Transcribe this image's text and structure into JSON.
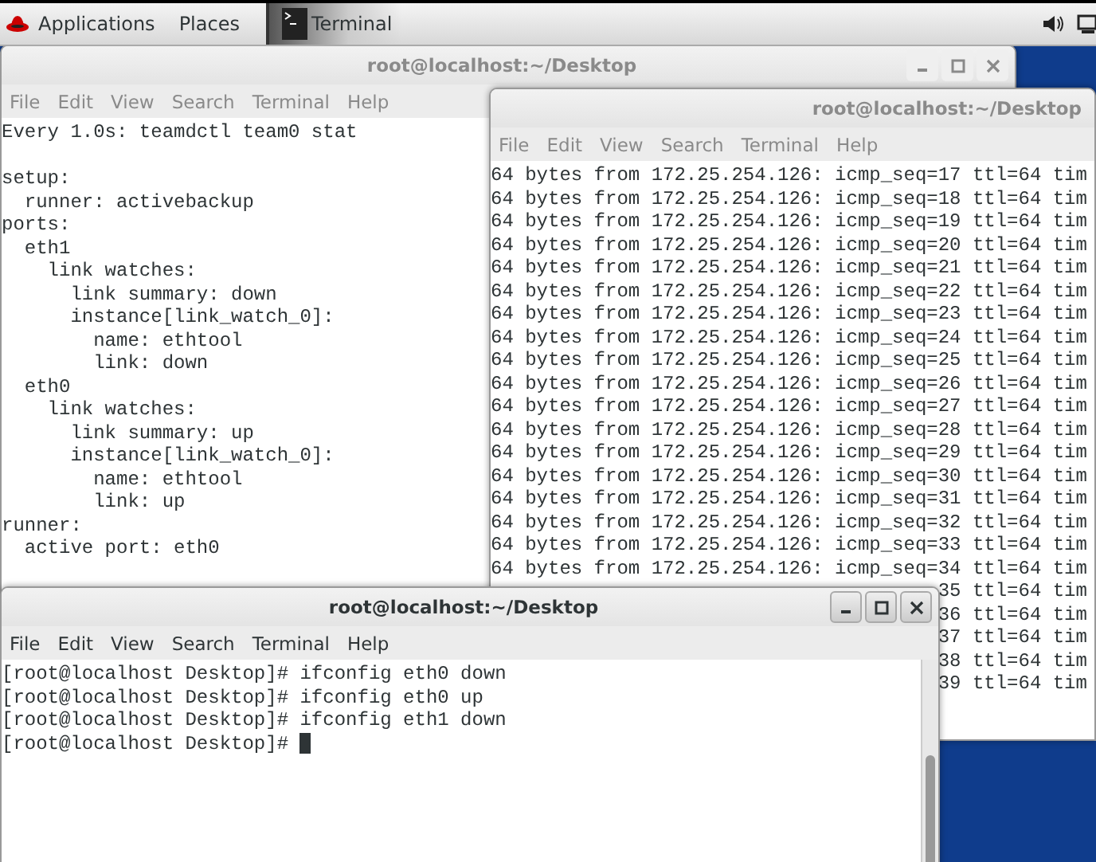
{
  "top_bar": {
    "menus": [
      "Applications",
      "Places"
    ],
    "task": {
      "label": "Terminal"
    }
  },
  "windows": [
    {
      "title": "root@localhost:~/Desktop",
      "active": false,
      "menu": [
        "File",
        "Edit",
        "View",
        "Search",
        "Terminal",
        "Help"
      ],
      "cursor": false,
      "lines": [
        {
          "text": "Every 1.0s: teamdctl team0 stat",
          "kind": "full"
        },
        {
          "text": "setup:",
          "kind": "gap"
        },
        {
          "text": "  runner: activebackup",
          "kind": "full"
        },
        {
          "text": "ports:",
          "kind": "full"
        },
        {
          "text": "  eth1",
          "kind": "full"
        },
        {
          "text": "    link watches:",
          "kind": "full"
        },
        {
          "text": "      link summary: down",
          "kind": "full"
        },
        {
          "text": "      instance[link_watch_0]:",
          "kind": "full"
        },
        {
          "text": "        name: ethtool",
          "kind": "full"
        },
        {
          "text": "        link: down",
          "kind": "full"
        },
        {
          "text": "  eth0",
          "kind": "full"
        },
        {
          "text": "    link watches:",
          "kind": "full"
        },
        {
          "text": "      link summary: up",
          "kind": "full"
        },
        {
          "text": "      instance[link_watch_0]:",
          "kind": "full"
        },
        {
          "text": "        name: ethtool",
          "kind": "full"
        },
        {
          "text": "        link: up",
          "kind": "full"
        },
        {
          "text": "runner:",
          "kind": "full"
        },
        {
          "text": "  active port: eth0",
          "kind": "full"
        }
      ]
    },
    {
      "title": "root@localhost:~/Desktop",
      "active": false,
      "menu": [
        "File",
        "Edit",
        "View",
        "Search",
        "Terminal",
        "Help"
      ],
      "cursor": false,
      "lines": [
        {
          "text": "64 bytes from 172.25.254.126: icmp_seq=17 ttl=64 tim",
          "kind": "full"
        },
        {
          "text": "64 bytes from 172.25.254.126: icmp_seq=18 ttl=64 tim",
          "kind": "full"
        },
        {
          "text": "64 bytes from 172.25.254.126: icmp_seq=19 ttl=64 tim",
          "kind": "full"
        },
        {
          "text": "64 bytes from 172.25.254.126: icmp_seq=20 ttl=64 tim",
          "kind": "full"
        },
        {
          "text": "64 bytes from 172.25.254.126: icmp_seq=21 ttl=64 tim",
          "kind": "full"
        },
        {
          "text": "64 bytes from 172.25.254.126: icmp_seq=22 ttl=64 tim",
          "kind": "full"
        },
        {
          "text": "64 bytes from 172.25.254.126: icmp_seq=23 ttl=64 tim",
          "kind": "full"
        },
        {
          "text": "64 bytes from 172.25.254.126: icmp_seq=24 ttl=64 tim",
          "kind": "full"
        },
        {
          "text": "64 bytes from 172.25.254.126: icmp_seq=25 ttl=64 tim",
          "kind": "full"
        },
        {
          "text": "64 bytes from 172.25.254.126: icmp_seq=26 ttl=64 tim",
          "kind": "full"
        },
        {
          "text": "64 bytes from 172.25.254.126: icmp_seq=27 ttl=64 tim",
          "kind": "full"
        },
        {
          "text": "64 bytes from 172.25.254.126: icmp_seq=28 ttl=64 tim",
          "kind": "full"
        },
        {
          "text": "64 bytes from 172.25.254.126: icmp_seq=29 ttl=64 tim",
          "kind": "full"
        },
        {
          "text": "64 bytes from 172.25.254.126: icmp_seq=30 ttl=64 tim",
          "kind": "full"
        },
        {
          "text": "64 bytes from 172.25.254.126: icmp_seq=31 ttl=64 tim",
          "kind": "full"
        },
        {
          "text": "64 bytes from 172.25.254.126: icmp_seq=32 ttl=64 tim",
          "kind": "full"
        },
        {
          "text": "64 bytes from 172.25.254.126: icmp_seq=33 ttl=64 tim",
          "kind": "full"
        },
        {
          "text": "64 bytes from 172.25.254.126: icmp_seq=34 ttl=64 tim",
          "kind": "full"
        },
        {
          "text": "35 ttl=64 tim",
          "kind": "tail"
        },
        {
          "text": "36 ttl=64 tim",
          "kind": "tail"
        },
        {
          "text": "37 ttl=64 tim",
          "kind": "tail"
        },
        {
          "text": "38 ttl=64 tim",
          "kind": "tail"
        },
        {
          "text": "39 ttl=64 tim",
          "kind": "tail"
        }
      ]
    },
    {
      "title": "root@localhost:~/Desktop",
      "active": true,
      "menu": [
        "File",
        "Edit",
        "View",
        "Search",
        "Terminal",
        "Help"
      ],
      "cursor": true,
      "lines": [
        {
          "text": "[root@localhost Desktop]# ifconfig eth0 down",
          "kind": "full"
        },
        {
          "text": "[root@localhost Desktop]# ifconfig eth0 up",
          "kind": "full"
        },
        {
          "text": "[root@localhost Desktop]# ifconfig eth1 down",
          "kind": "full"
        },
        {
          "text": "[root@localhost Desktop]#",
          "kind": "full"
        }
      ]
    }
  ]
}
